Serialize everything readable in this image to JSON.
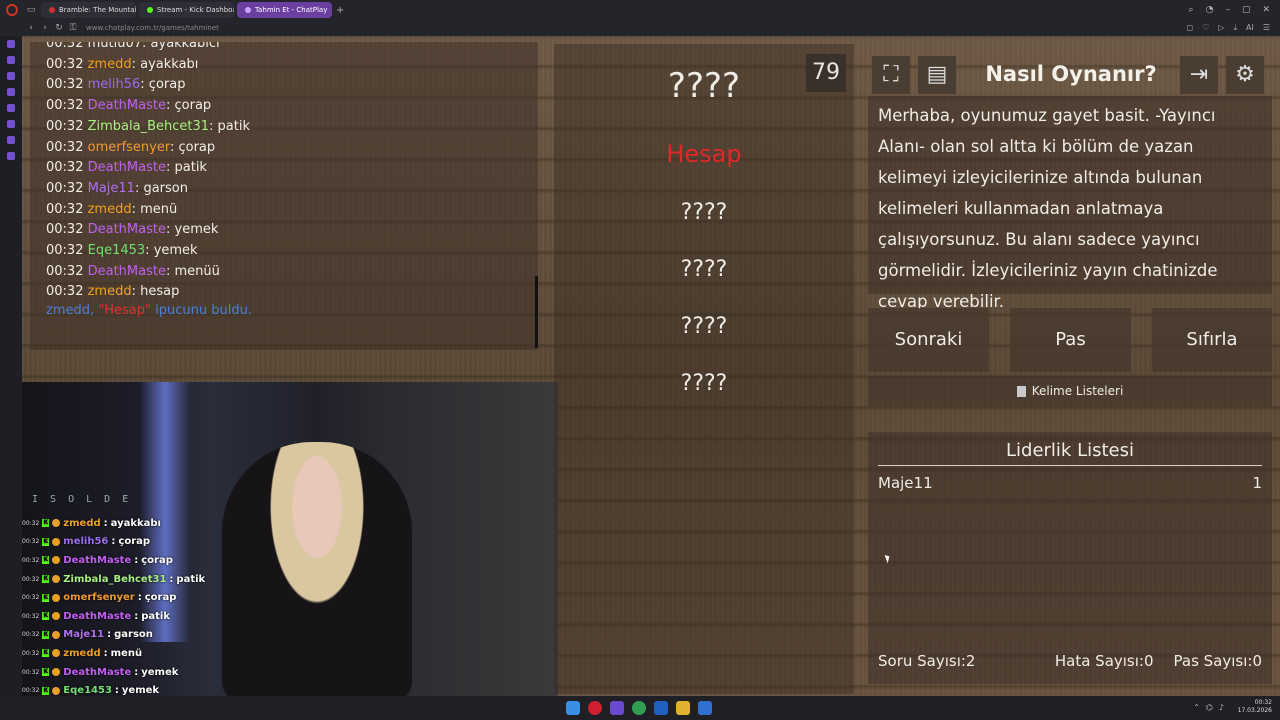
{
  "browser": {
    "tabs": [
      {
        "label": "Bramble: The Mountain K",
        "color": "#d03030"
      },
      {
        "label": "Stream - Kick Dashboard",
        "color": "#53fc18"
      },
      {
        "label": "Tahmin Et - ChatPlay",
        "color": "#8b5cf6",
        "active": true
      }
    ],
    "url": "www.chatplay.com.tr/games/tahminet"
  },
  "chat_log": [
    {
      "time": "00:32",
      "user": "mutlu07",
      "msg": "ayakkabıcı",
      "color": "#f2eee8"
    },
    {
      "time": "00:32",
      "user": "zmedd",
      "msg": "ayakkabı",
      "color": "#f0a020"
    },
    {
      "time": "00:32",
      "user": "melih56",
      "msg": "çorap",
      "color": "#9b6cf0"
    },
    {
      "time": "00:32",
      "user": "DeathMaste",
      "msg": "çorap",
      "color": "#c060f0"
    },
    {
      "time": "00:32",
      "user": "Zimbala_Behcet31",
      "msg": "patik",
      "color": "#a8f080"
    },
    {
      "time": "00:32",
      "user": "omerfsenyer",
      "msg": "çorap",
      "color": "#f09a30"
    },
    {
      "time": "00:32",
      "user": "DeathMaste",
      "msg": "patik",
      "color": "#c060f0"
    },
    {
      "time": "00:32",
      "user": "Maje11",
      "msg": "garson",
      "color": "#b070f0"
    },
    {
      "time": "00:32",
      "user": "zmedd",
      "msg": "menü",
      "color": "#f0a020"
    },
    {
      "time": "00:32",
      "user": "DeathMaste",
      "msg": "yemek",
      "color": "#c060f0"
    },
    {
      "time": "00:32",
      "user": "Eqe1453",
      "msg": "yemek",
      "color": "#70e070"
    },
    {
      "time": "00:32",
      "user": "DeathMaste",
      "msg": "menüü",
      "color": "#c060f0"
    },
    {
      "time": "00:32",
      "user": "zmedd",
      "msg": "hesap",
      "color": "#f0a020"
    }
  ],
  "hint": {
    "pre": "zmedd, ",
    "word": "\"Hesap\"",
    "post": " ipucunu buldu."
  },
  "stream_overlay": {
    "sign": "I S O L D E",
    "chat": [
      {
        "time": "00:32",
        "user": "zmedd",
        "msg": "ayakkabı",
        "color": "#f0a020"
      },
      {
        "time": "00:32",
        "user": "melih56",
        "msg": "çorap",
        "color": "#9b6cf0"
      },
      {
        "time": "00:32",
        "user": "DeathMaste",
        "msg": "çorap",
        "color": "#c060f0"
      },
      {
        "time": "00:32",
        "user": "Zimbala_Behcet31",
        "msg": "patik",
        "color": "#a8f080"
      },
      {
        "time": "00:32",
        "user": "omerfsenyer",
        "msg": "çorap",
        "color": "#f09a30"
      },
      {
        "time": "00:32",
        "user": "DeathMaste",
        "msg": "patik",
        "color": "#c060f0"
      },
      {
        "time": "00:32",
        "user": "Maje11",
        "msg": "garson",
        "color": "#b070f0"
      },
      {
        "time": "00:32",
        "user": "zmedd",
        "msg": "menü",
        "color": "#f0a020"
      },
      {
        "time": "00:32",
        "user": "DeathMaste",
        "msg": "yemek",
        "color": "#c060f0"
      },
      {
        "time": "00:32",
        "user": "Eqe1453",
        "msg": "yemek",
        "color": "#70e070"
      }
    ]
  },
  "game": {
    "timer": "79",
    "secret_word": "????",
    "revealed_word": "Hesap",
    "revealed_color": "#e02828",
    "hidden_words": [
      "????",
      "????",
      "????",
      "????"
    ],
    "how_to_play_title": "Nasıl Oynanır?",
    "how_to_play_text": "Merhaba, oyunumuz gayet basit. -Yayıncı Alanı- olan sol altta ki bölüm de yazan kelimeyi izleyicilerinize altında bulunan kelimeleri kullanmadan anlatmaya çalışıyorsunuz. Bu alanı sadece yayıncı görmelidir. İzleyicileriniz yayın chatinizde cevap verebilir.",
    "buttons": {
      "next": "Sonraki",
      "pass": "Pas",
      "reset": "Sıfırla"
    },
    "word_lists": "Kelime Listeleri",
    "leaderboard_title": "Liderlik Listesi",
    "leaderboard": [
      {
        "name": "Maje11",
        "score": "1"
      }
    ],
    "stats": {
      "questions": "Soru Sayısı:2",
      "errors": "Hata Sayısı:0",
      "passes": "Pas Sayısı:0"
    }
  },
  "taskbar": {
    "time": "00:32",
    "date": "17.03.2026"
  }
}
